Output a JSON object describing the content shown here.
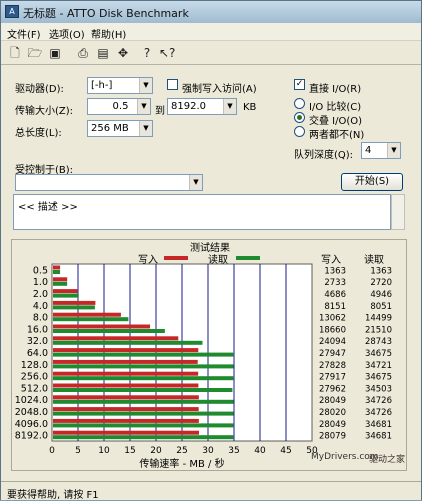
{
  "window": {
    "title": "无标题 - ATTO Disk Benchmark"
  },
  "menu": [
    "文件(F)",
    "选项(O)",
    "帮助(H)"
  ],
  "toolbar": {
    "icons": [
      "new-icon",
      "open-icon",
      "save-icon",
      "print-icon",
      "print-preview-icon",
      "move-icon",
      "help-icon",
      "context-help-icon"
    ]
  },
  "form": {
    "drive_label": "驱动器(D):",
    "drive_value": "[-h-]",
    "force_write_label": "强制写入访问(A)",
    "force_write_checked": false,
    "direct_io_label": "直接 I/O(R)",
    "direct_io_checked": true,
    "transfer_label": "传输大小(Z):",
    "transfer_from": "0.5",
    "to_label": "到",
    "transfer_to": "8192.0",
    "kb_label": "KB",
    "length_label": "总长度(L):",
    "length_value": "256 MB",
    "io_compare_label": "I/O 比较(C)",
    "io_overlap_label": "交叠 I/O(O)",
    "neither_label": "两者都不(N)",
    "queue_label": "队列深度(Q):",
    "queue_value": "4",
    "controlled_label": "受控制于(B):",
    "controlled_value": "",
    "start_button": "开始(S)",
    "description": "<< 描述 >>"
  },
  "results": {
    "title": "测试结果",
    "legend_write": "写入",
    "legend_read": "读取",
    "col_write": "写入",
    "col_read": "读取",
    "write_color": "#c62828",
    "read_color": "#1f8a2e"
  },
  "chart_data": {
    "type": "bar",
    "title": "测试结果",
    "xlabel": "传输速率 - MB / 秒",
    "ylabel": "",
    "xlim": [
      0,
      50
    ],
    "xticks": [
      0,
      5,
      10,
      15,
      20,
      25,
      30,
      35,
      40,
      45,
      50
    ],
    "categories": [
      "0.5",
      "1.0",
      "2.0",
      "4.0",
      "8.0",
      "16.0",
      "32.0",
      "64.0",
      "128.0",
      "256.0",
      "512.0",
      "1024.0",
      "2048.0",
      "4096.0",
      "8192.0"
    ],
    "series": [
      {
        "name": "写入",
        "values": [
          1.363,
          2.733,
          4.686,
          8.151,
          13.062,
          18.66,
          24.094,
          27.947,
          27.828,
          27.917,
          27.962,
          28.049,
          28.02,
          28.049,
          28.079
        ],
        "labels": [
          "1363",
          "2733",
          "4686",
          "8151",
          "13062",
          "18660",
          "24094",
          "27947",
          "27828",
          "27917",
          "27962",
          "28049",
          "28020",
          "28049",
          "28079"
        ]
      },
      {
        "name": "读取",
        "values": [
          1.363,
          2.72,
          4.946,
          8.051,
          14.499,
          21.51,
          28.743,
          34.675,
          34.721,
          34.675,
          34.503,
          34.726,
          34.726,
          34.681,
          34.681
        ],
        "labels": [
          "1363",
          "2720",
          "4946",
          "8051",
          "14499",
          "21510",
          "28743",
          "34675",
          "34721",
          "34675",
          "34503",
          "34726",
          "34726",
          "34681",
          "34681"
        ]
      }
    ],
    "grid": true,
    "legend": "top-center"
  },
  "status": {
    "text": "要获得帮助, 请按 F1"
  },
  "watermark": {
    "site": "MyDrivers.com",
    "name": "驱动之家"
  }
}
